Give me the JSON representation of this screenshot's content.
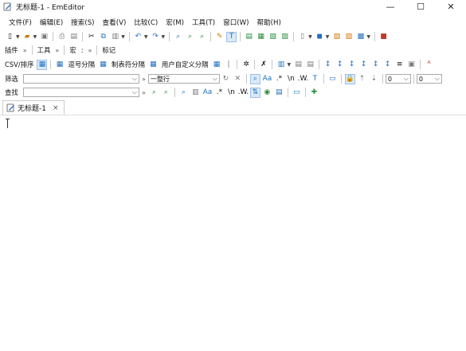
{
  "window": {
    "title": "无标题-1 - EmEditor",
    "minimize_glyph": "—",
    "maximize_glyph": "☐",
    "close_glyph": "✕"
  },
  "menu": [
    "文件(F)",
    "编辑(E)",
    "搜索(S)",
    "查看(V)",
    "比较(C)",
    "宏(M)",
    "工具(T)",
    "窗口(W)",
    "帮助(H)"
  ],
  "toolbar_row2": {
    "plugins": "插件",
    "tools": "工具",
    "macros": "宏",
    "macro_sep": ":",
    "mark": "标记"
  },
  "csv_bar": {
    "csv_sort": "CSV/排序",
    "comma": "逗号分隔",
    "tab": "制表符分隔",
    "user": "用户自定义分隔"
  },
  "filter_bar": {
    "label": "筛选",
    "mode": "一整行",
    "num1": "0",
    "num2": "0",
    "regex_label": "\\n",
    "w_label": ".W."
  },
  "find_bar": {
    "label": "查找",
    "regex_label": "\\n",
    "w_label": ".W."
  },
  "tab": {
    "label": "无标题-1",
    "close": "×"
  },
  "icons": {
    "accent": "#1f6fc0"
  }
}
